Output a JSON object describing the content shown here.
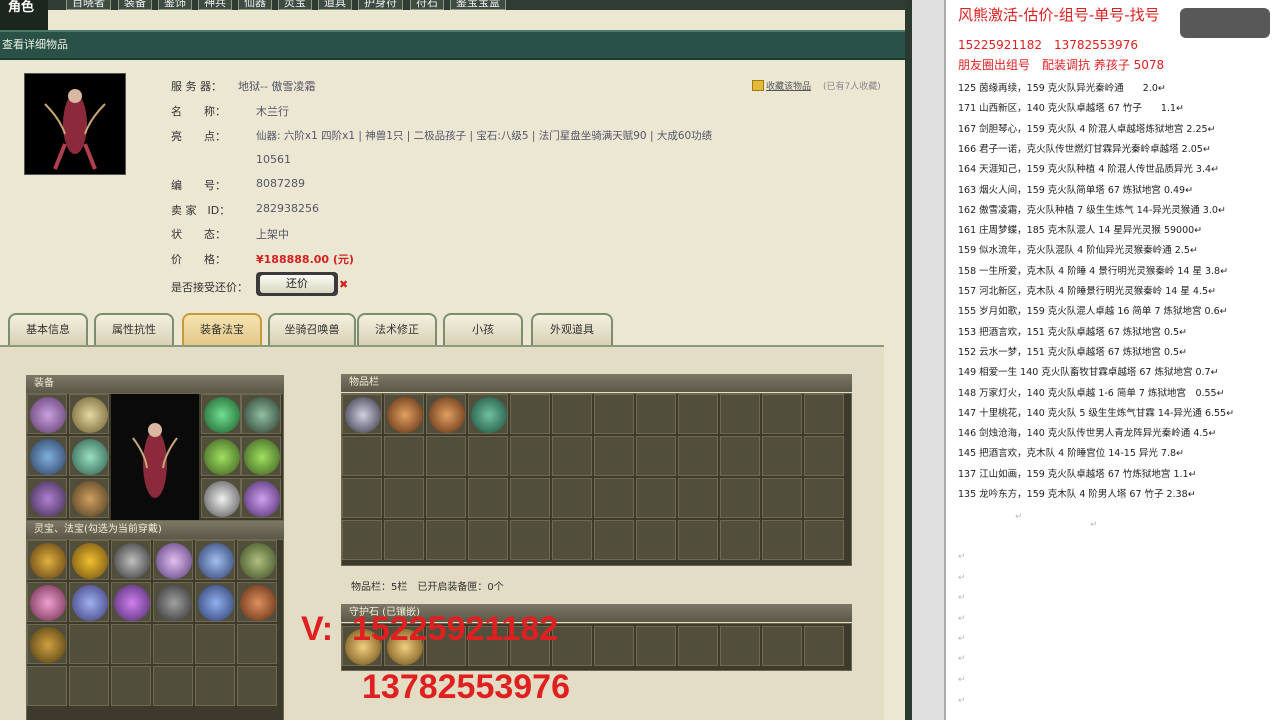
{
  "topnav": {
    "tabs": [
      "百晓者",
      "装备",
      "鉴饰",
      "神兵",
      "仙器",
      "灵宝",
      "道具",
      "护身符",
      "符石",
      "鉴宝宝盒"
    ],
    "title": "角色"
  },
  "section_bar": {
    "title": "查看详细物品"
  },
  "detail": {
    "server_label": "服 务 器：",
    "server_value": "地狱-- 傲雪凌霜",
    "name_label": "名　　称：",
    "name_value": "木兰行",
    "highlight_label": "亮　　点：",
    "highlight_value": "仙器: 六阶x1 四阶x1 | 神兽1只 | 二极品孩子 | 宝石:八级5 | 法门星盘坐骑满天赋90 | 大成60功绩",
    "highlight_value2": "10561",
    "number_label": "编　　号：",
    "number_value": "8087289",
    "seller_label": "卖 家　ID：",
    "seller_value": "282938256",
    "status_label": "状　　态：",
    "status_value": "上架中",
    "price_label": "价　　格：",
    "price_value": "¥188888.00 (元)",
    "bargain_label": "是否接受还价：",
    "bargain_button": "还价",
    "collect_link": "收藏该物品",
    "collect_count": "(已有7人收藏)"
  },
  "tabs": [
    "基本信息",
    "属性抗性",
    "装备法宝",
    "坐骑召唤兽",
    "法术修正",
    "小孩",
    "外观道具"
  ],
  "panels": {
    "equip_title": "装备",
    "treasure_title": "灵宝、法宝(勾选为当前穿戴)",
    "bag_title": "物品栏",
    "bag_stats": "物品栏：5栏　已开启装备匣：0个",
    "guard_title": "守护石 (已镶嵌)"
  },
  "watermark": {
    "line1": "V:  15225921182",
    "line2": "13782553976"
  },
  "doc": {
    "header": "风熊激活-估价-组号-单号-找号",
    "phone": "15225921182　13782553976",
    "sub": "朋友圈出组号　配装调抗 养孩子 5078",
    "lines": [
      "125 茵缘再续，159 克火队异光秦岭通　　2.0↵",
      "171 山西新区，140 克火队卓越塔 67 竹子　　1.1↵",
      "167 剑胆琴心，159 克火队 4 阶混人卓越塔炼狱地宫 2.25↵",
      "166 君子一诺，克火队传世燃灯甘霖异光秦岭卓越塔 2.05↵",
      "164 天涯知己，159 克火队种植 4 阶混人传世品质异光 3.4↵",
      "163 烟火人间，159 克火队简单塔 67 炼狱地宫 0.49↵",
      "162 傲雪凌霜，克火队种植 7 级生生炼气 14-异光灵猴通 3.0↵",
      "161 庄周梦蝶，185 克木队混人 14 星异光灵猴 59000↵",
      "159 似水流年，克火队混队 4 阶仙异光灵猴秦岭通 2.5↵",
      "158 一生所爱，克木队 4 阶睡 4 景行明光灵猴秦岭 14 星 3.8↵",
      "157 河北新区，克木队 4 阶睡景行明光灵猴秦岭 14 星 4.5↵",
      "155 岁月如歌，159 克火队混人卓越 16 简单 7 炼狱地宫 0.6↵",
      "153 把酒言欢，151 克火队卓越塔 67 炼狱地宫 0.5↵",
      "152 云水一梦，151 克火队卓越塔 67 炼狱地宫 0.5↵",
      "149 相爱一生 140 克火队畜牧甘霖卓越塔 67 炼狱地宫 0.7↵",
      "148 万家灯火，140 克火队卓越 1-6 简单 7 炼狱地宫　0.55↵",
      "147 十里桃花，140 克火队 5 级生生炼气甘霖 14-异光通 6.55↵",
      "146 剑烛沧海，140 克火队传世男人青龙阵异光秦岭通 4.5↵",
      "145 把酒言欢，克木队 4 阶睡宫位 14-15 异光 7.8↵",
      "137 江山如画，159 克火队卓越塔 67 竹炼狱地宫 1.1↵",
      "135 龙吟东方，159 克木队 4 阶男人塔 67 竹子 2.38↵"
    ],
    "para_mark": "↵"
  },
  "colors": {
    "accent_red": "#e02020",
    "bar_green": "#2a5147"
  }
}
